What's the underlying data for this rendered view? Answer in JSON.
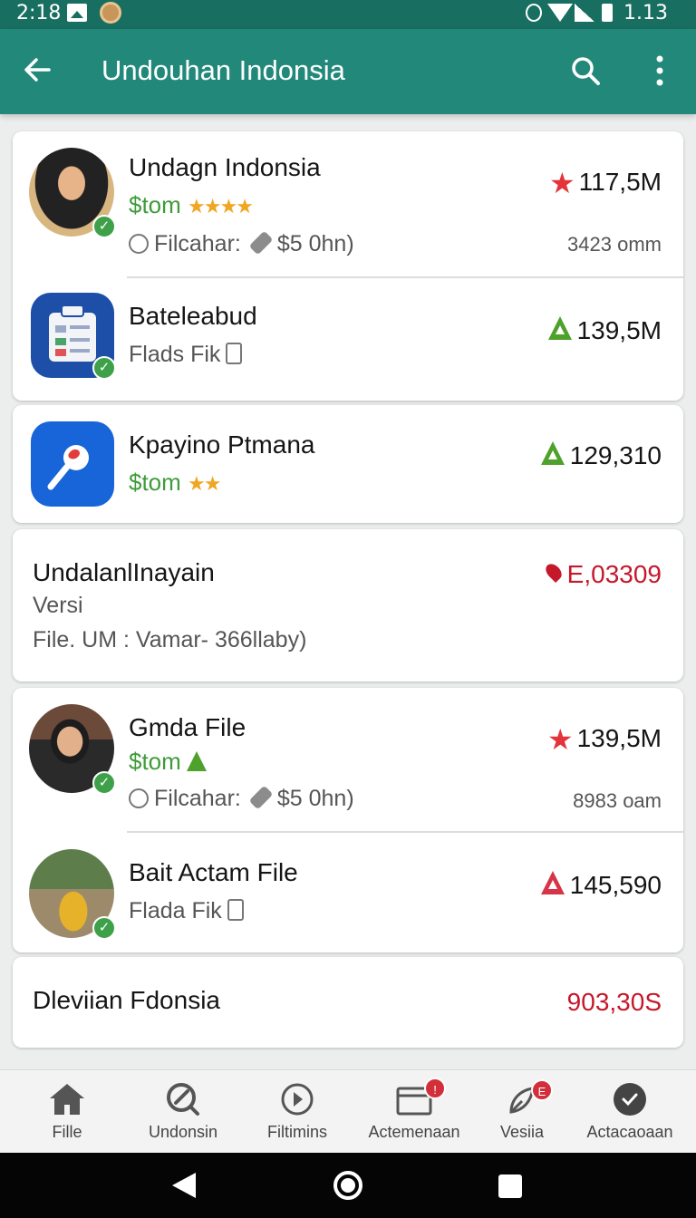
{
  "status_bar": {
    "time": "2:18",
    "battery_text": "1.13"
  },
  "app_bar": {
    "title": "Undouhan Indonsia"
  },
  "list": [
    {
      "name": "Undagn Indonsia",
      "sub": "$tom",
      "stars": "★★★★",
      "meta_a": "Filcahar:",
      "meta_b": "$5 0hn)",
      "value": "117,5M",
      "sub2": "3423 omm"
    },
    {
      "name": "Bateleabud",
      "meta": "Flads Fik",
      "value": "139,5M"
    },
    {
      "name": "Kpayino Ptmana",
      "sub": "$tom",
      "stars": "★★",
      "value": "129,310"
    },
    {
      "name": "UndalanlInayain",
      "line2": "Versi",
      "line3": "File. UM : Vamar- 366llaby)",
      "value": "E,03309"
    },
    {
      "name": "Gmda File",
      "sub": "$tom",
      "meta_a": "Filcahar:",
      "meta_b": "$5 0hn)",
      "value": "139,5M",
      "sub2": "8983 oam"
    },
    {
      "name": "Bait Actam File",
      "meta": "Flada Fik",
      "value": "145,590"
    },
    {
      "name": "Dleviian Fdonsia",
      "value": "903,30S"
    }
  ],
  "bottom_nav": [
    {
      "label": "Fille"
    },
    {
      "label": "Undonsin"
    },
    {
      "label": "Filtimins"
    },
    {
      "label": "Actemenaan",
      "badge": "!"
    },
    {
      "label": "Vesiia",
      "badge": "E"
    },
    {
      "label": "Actacaoaan"
    }
  ],
  "colors": {
    "status_bar": "#186e60",
    "app_bar": "#22897a",
    "accent_green": "#3f9b3a",
    "value_red": "#c5182b",
    "star_red": "#e5333b"
  }
}
